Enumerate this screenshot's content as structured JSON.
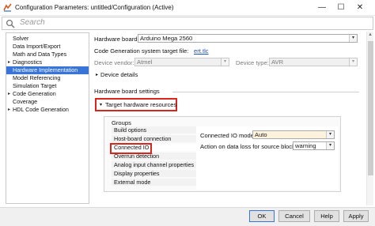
{
  "window": {
    "title": "Configuration Parameters: untitled/Configuration (Active)",
    "minimize": "—",
    "maximize": "☐",
    "close": "✕"
  },
  "search": {
    "placeholder": "Search"
  },
  "tree": {
    "items": [
      {
        "label": "Solver",
        "expandable": false,
        "selected": false
      },
      {
        "label": "Data Import/Export",
        "expandable": false,
        "selected": false
      },
      {
        "label": "Math and Data Types",
        "expandable": false,
        "selected": false
      },
      {
        "label": "Diagnostics",
        "expandable": true,
        "selected": false
      },
      {
        "label": "Hardware Implementation",
        "expandable": false,
        "selected": true
      },
      {
        "label": "Model Referencing",
        "expandable": false,
        "selected": false
      },
      {
        "label": "Simulation Target",
        "expandable": false,
        "selected": false
      },
      {
        "label": "Code Generation",
        "expandable": true,
        "selected": false
      },
      {
        "label": "Coverage",
        "expandable": false,
        "selected": false
      },
      {
        "label": "HDL Code Generation",
        "expandable": true,
        "selected": false
      }
    ],
    "expand_glyph": "▸"
  },
  "hardware": {
    "board_label": "Hardware board:",
    "board_value": "Arduino Mega 2560",
    "target_file_label": "Code Generation system target file:",
    "target_file_link": "ert.tlc",
    "vendor_label": "Device vendor:",
    "vendor_value": "Atmel",
    "type_label": "Device type:",
    "type_value": "AVR",
    "device_details": "Device details",
    "board_settings": "Hardware board settings",
    "target_resources": "Target hardware resources"
  },
  "groups": {
    "heading": "Groups",
    "items": [
      "Build options",
      "Host-board connection",
      "Connected IO",
      "Overrun detection",
      "Analog input channel properties",
      "Display properties",
      "External mode"
    ],
    "active_index": 2
  },
  "connected_io": {
    "mode_label": "Connected IO mode:",
    "mode_value": "Auto",
    "data_loss_label": "Action on data loss for source blocks:",
    "data_loss_value": "warning"
  },
  "glyphs": {
    "collapsed": "▸",
    "expanded": "▾",
    "dropdown": "▾",
    "scroll_up": "▲"
  },
  "buttons": {
    "ok": "OK",
    "cancel": "Cancel",
    "help": "Help",
    "apply": "Apply"
  },
  "colors": {
    "selection": "#3875d7",
    "highlight_box": "#d9261c",
    "link": "#1a4fb0"
  }
}
